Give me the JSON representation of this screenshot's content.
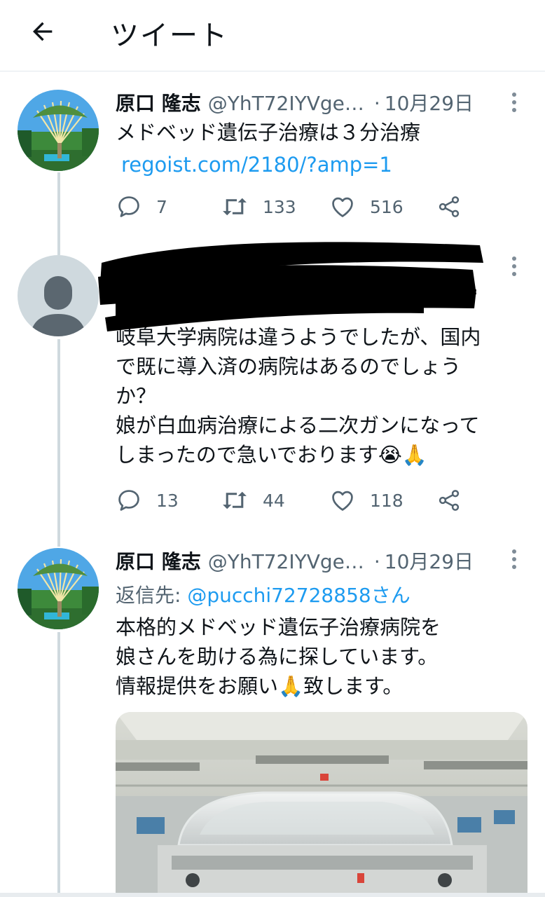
{
  "header": {
    "title": "ツイート",
    "back_icon": "arrow-left-icon"
  },
  "tweets": [
    {
      "author": "原口 隆志",
      "handle": "@YhT72IYVge…",
      "dot": "·",
      "date": "10月29日",
      "text": "メドベッド遺伝子治療は３分治療",
      "link": "regoist.com/2180/?amp=1",
      "replies": "7",
      "retweets": "133",
      "likes": "516"
    },
    {
      "author_redacted": true,
      "lines": [
        "岐阜大学病院は違うようでしたが、国内",
        "で既に導入済の病院はあるのでしょう",
        "か？",
        "娘が白血病治療による二次ガンになって",
        "しまったので急いでおります😭🙏"
      ],
      "replies": "13",
      "retweets": "44",
      "likes": "118"
    },
    {
      "author": "原口 隆志",
      "handle": "@YhT72IYVge…",
      "dot": "·",
      "date": "10月29日",
      "reply_label": "返信先: ",
      "reply_mention": "@pucchi72728858さん",
      "lines": [
        "本格的メドベッド遺伝子治療病院を",
        "娘さんを助ける為に探しています。",
        "情報提供をお願い🙏致します。"
      ]
    }
  ],
  "colors": {
    "link": "#1d9bf0",
    "secondary": "#536471",
    "text": "#0f1419",
    "thread": "#cfd9de"
  }
}
